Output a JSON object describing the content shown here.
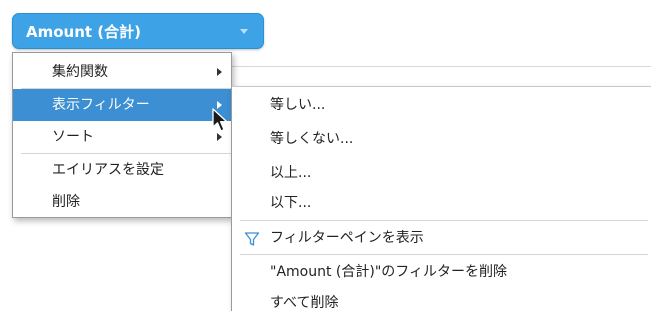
{
  "measure": {
    "label": "Amount (合計)"
  },
  "main_menu": {
    "items": [
      {
        "label": "集約関数"
      },
      {
        "label": "表示フィルター"
      },
      {
        "label": "ソート"
      },
      {
        "label": "エイリアスを設定"
      },
      {
        "label": "削除"
      }
    ],
    "active_item": "表示フィルター"
  },
  "filter_submenu": {
    "items": [
      {
        "label": "等しい..."
      },
      {
        "label": "等しくない..."
      },
      {
        "label": "以上..."
      },
      {
        "label": "以下..."
      },
      {
        "label": "フィルターペインを表示",
        "icon": "filter-icon"
      },
      {
        "label": "\"Amount (合計)\"のフィルターを削除"
      },
      {
        "label": "すべて削除"
      }
    ]
  },
  "colors": {
    "accent": "#3ea3e6",
    "highlight": "#3b8fd2"
  }
}
